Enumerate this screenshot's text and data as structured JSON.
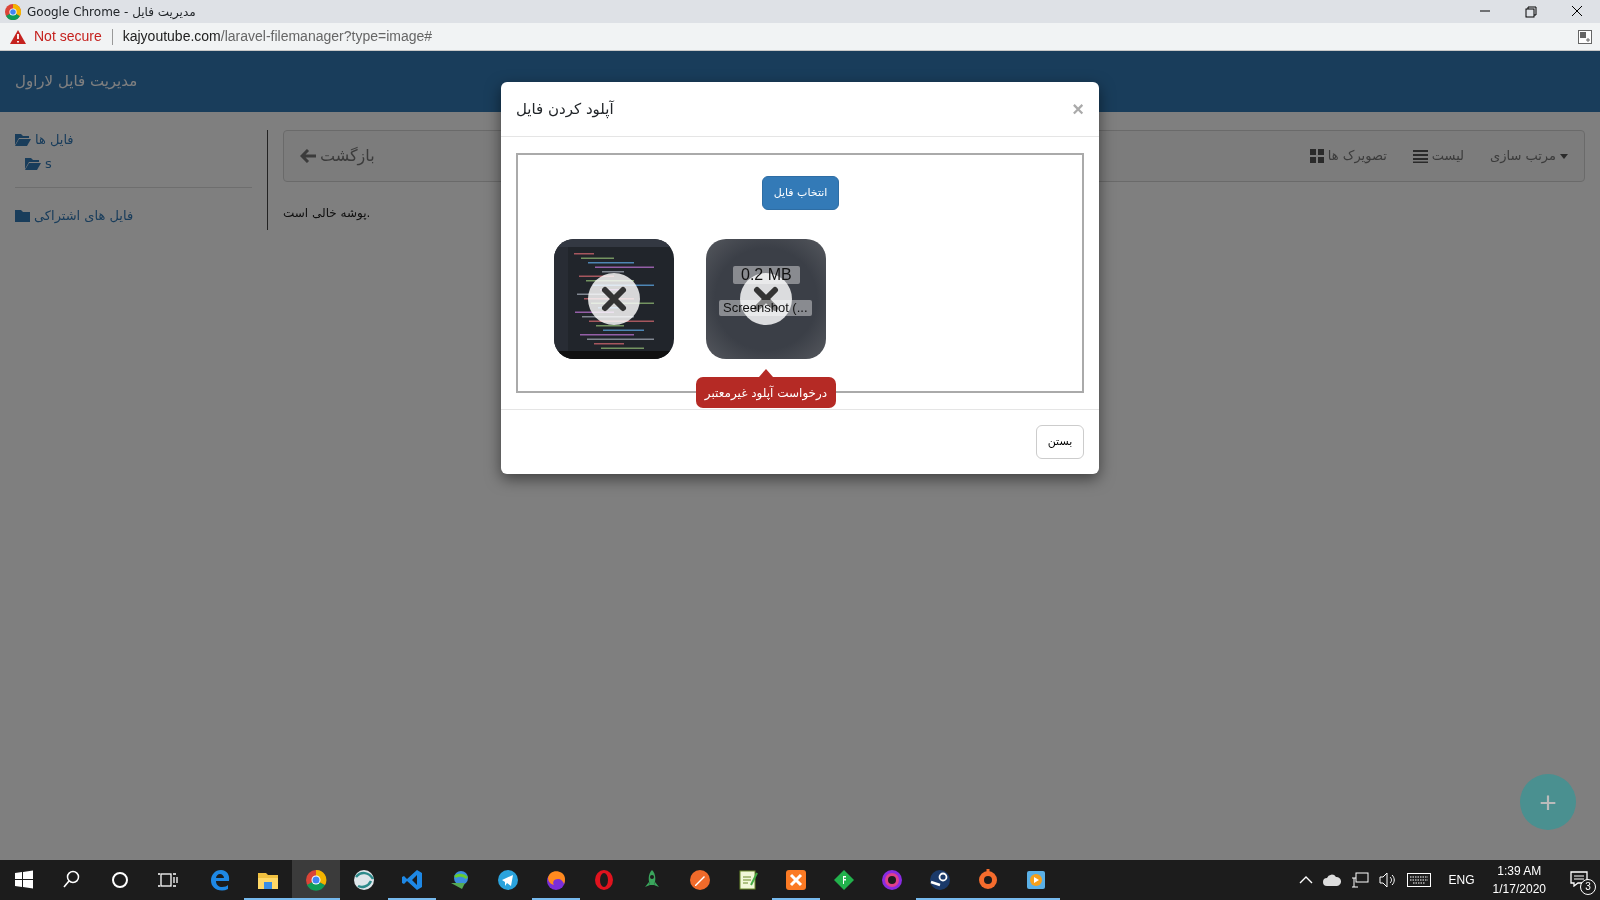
{
  "browser": {
    "title": "Google Chrome - مدیریت فایل",
    "security": "Not secure",
    "url": "kajyoutube.com/laravel-filemanager?type=image#"
  },
  "header": {
    "title": "مدیریت فایل لاراول"
  },
  "sidebar": {
    "items": [
      {
        "label": "فایل ها",
        "expanded": true,
        "children": [
          {
            "label": "s",
            "expanded": true
          }
        ]
      },
      {
        "label": "فایل های اشتراکی",
        "expanded": false
      }
    ]
  },
  "toolbar": {
    "back": "بازگشت",
    "thumbnails": "تصویرک ها",
    "list": "لیست",
    "sort": "مرتب سازی"
  },
  "content": {
    "message": "پوشه خالی است."
  },
  "modal": {
    "title": "آپلود کردن فایل",
    "close": "×",
    "choose_button": "انتخاب فایل",
    "files": [
      {
        "kind": "image"
      },
      {
        "kind": "error",
        "size": "0.2 MB",
        "name": "Screenshot (...",
        "error": "درخواست آپلود غیرمعتبر"
      }
    ],
    "footer_button": "بستن"
  },
  "fab": {
    "label": "+"
  },
  "taskbar": {
    "apps": [
      {
        "running": false,
        "selected": false
      },
      {
        "running": true,
        "selected": false
      },
      {
        "running": true,
        "selected": true
      },
      {
        "running": false,
        "selected": false
      },
      {
        "running": true,
        "selected": false
      },
      {
        "running": false,
        "selected": false
      },
      {
        "running": false,
        "selected": false
      },
      {
        "running": true,
        "selected": false
      },
      {
        "running": false,
        "selected": false
      },
      {
        "running": false,
        "selected": false
      },
      {
        "running": false,
        "selected": false
      },
      {
        "running": false,
        "selected": false
      },
      {
        "running": true,
        "selected": false
      },
      {
        "running": false,
        "selected": false
      },
      {
        "running": false,
        "selected": false
      },
      {
        "running": true,
        "selected": false
      },
      {
        "running": true,
        "selected": false
      },
      {
        "running": true,
        "selected": false
      }
    ],
    "tray": {
      "language": "ENG",
      "time": "1:39 AM",
      "date": "1/17/2020",
      "notifications": "3"
    }
  }
}
